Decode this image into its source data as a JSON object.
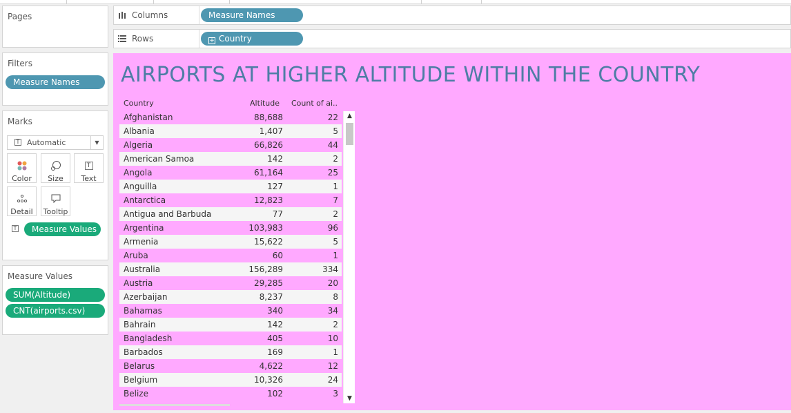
{
  "columns_shelf": {
    "label": "Columns",
    "pill": "Measure Names"
  },
  "rows_shelf": {
    "label": "Rows",
    "pill": "Country"
  },
  "pages": {
    "title": "Pages"
  },
  "filters": {
    "title": "Filters",
    "pills": [
      "Measure Names"
    ]
  },
  "marks": {
    "title": "Marks",
    "mark_type": "Automatic",
    "cards": [
      {
        "label": "Color",
        "icon": "color-icon"
      },
      {
        "label": "Size",
        "icon": "size-icon"
      },
      {
        "label": "Text",
        "icon": "text-icon"
      },
      {
        "label": "Detail",
        "icon": "detail-icon"
      },
      {
        "label": "Tooltip",
        "icon": "tooltip-icon"
      }
    ],
    "text_pill": "Measure Values"
  },
  "measure_values": {
    "title": "Measure Values",
    "pills": [
      "SUM(Altitude)",
      "CNT(airports.csv)"
    ]
  },
  "viz": {
    "background": "#ffa9ff",
    "title": "AIRPORTS AT HIGHER ALTITUDE WITHIN THE COUNTRY",
    "headers": [
      "Country",
      "Altitude",
      "Count of ai.."
    ],
    "rows": [
      [
        "Afghanistan",
        "88,688",
        "22"
      ],
      [
        "Albania",
        "1,407",
        "5"
      ],
      [
        "Algeria",
        "66,826",
        "44"
      ],
      [
        "American Samoa",
        "142",
        "2"
      ],
      [
        "Angola",
        "61,164",
        "25"
      ],
      [
        "Anguilla",
        "127",
        "1"
      ],
      [
        "Antarctica",
        "12,823",
        "7"
      ],
      [
        "Antigua and Barbuda",
        "77",
        "2"
      ],
      [
        "Argentina",
        "103,983",
        "96"
      ],
      [
        "Armenia",
        "15,622",
        "5"
      ],
      [
        "Aruba",
        "60",
        "1"
      ],
      [
        "Australia",
        "156,289",
        "334"
      ],
      [
        "Austria",
        "29,285",
        "20"
      ],
      [
        "Azerbaijan",
        "8,237",
        "8"
      ],
      [
        "Bahamas",
        "340",
        "34"
      ],
      [
        "Bahrain",
        "142",
        "2"
      ],
      [
        "Bangladesh",
        "405",
        "10"
      ],
      [
        "Barbados",
        "169",
        "1"
      ],
      [
        "Belarus",
        "4,622",
        "12"
      ],
      [
        "Belgium",
        "10,326",
        "24"
      ],
      [
        "Belize",
        "102",
        "3"
      ]
    ]
  }
}
